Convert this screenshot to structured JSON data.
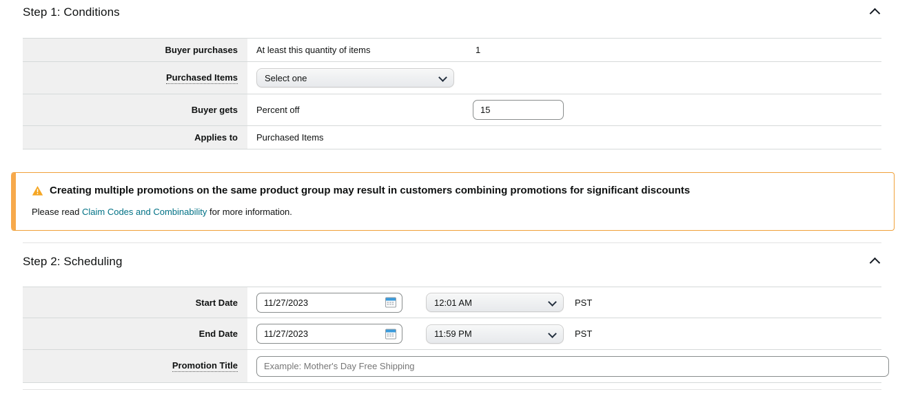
{
  "step1": {
    "title": "Step 1: Conditions",
    "collapse_icon": "chevron-up-icon",
    "rows": [
      {
        "label": "Buyer purchases",
        "label_tooltip": false,
        "text": "At least this quantity of items",
        "qty": "1"
      },
      {
        "label": "Purchased Items",
        "label_tooltip": true,
        "select_value": "Select one"
      },
      {
        "label": "Buyer gets",
        "label_tooltip": false,
        "text": "Percent off",
        "percent_value": "15"
      },
      {
        "label": "Applies to",
        "label_tooltip": false,
        "text": "Purchased Items"
      }
    ]
  },
  "alert": {
    "icon": "warning-triangle-icon",
    "heading": "Creating multiple promotions on the same product group may result in customers combining promotions for significant discounts",
    "body_prefix": "Please read ",
    "link_text": "Claim Codes and Combinability",
    "body_suffix": " for more information.",
    "accent_color": "#f7a94b",
    "border_color": "#f0a038",
    "link_color": "#007185"
  },
  "step2": {
    "title": "Step 2: Scheduling",
    "collapse_icon": "chevron-up-icon",
    "rows": [
      {
        "label": "Start Date",
        "label_tooltip": false,
        "date_value": "11/27/2023",
        "time_value": "12:01 AM",
        "timezone": "PST",
        "calendar_icon": "calendar-icon"
      },
      {
        "label": "End Date",
        "label_tooltip": false,
        "date_value": "11/27/2023",
        "time_value": "11:59 PM",
        "timezone": "PST",
        "calendar_icon": "calendar-icon"
      },
      {
        "label": "Promotion Title",
        "label_tooltip": true,
        "title_value": "",
        "title_placeholder": "Example: Mother's Day Free Shipping"
      }
    ]
  }
}
